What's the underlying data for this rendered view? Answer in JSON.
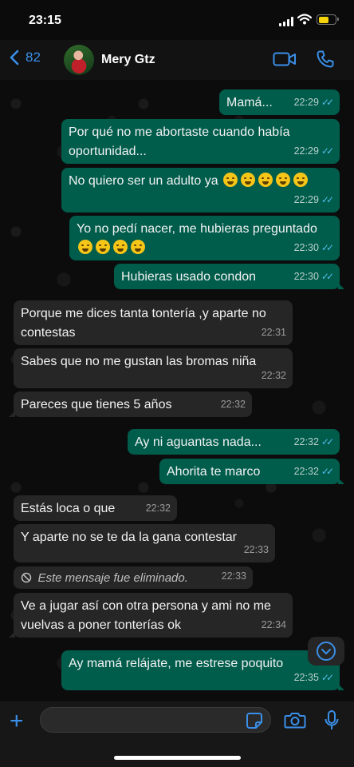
{
  "status_bar": {
    "time": "23:15"
  },
  "header": {
    "back_count": "82",
    "contact_name": "Mery Gtz"
  },
  "messages": [
    {
      "text": "Mamá...",
      "time": "22:29"
    },
    {
      "text": "Por qué no me abortaste cuando había oportunidad...",
      "time": "22:29"
    },
    {
      "text": "No quiero ser un adulto ya",
      "time": "22:29"
    },
    {
      "text": "Yo no pedí nacer, me hubieras preguntado",
      "time": "22:30"
    },
    {
      "text": "Hubieras usado condon",
      "time": "22:30"
    },
    {
      "text": "Porque me dices tanta tontería ,y aparte no contestas",
      "time": "22:31"
    },
    {
      "text": "Sabes que no me gustan las bromas niña",
      "time": "22:32"
    },
    {
      "text": "Pareces que tienes 5 años",
      "time": "22:32"
    },
    {
      "text": "Ay ni aguantas nada...",
      "time": "22:32"
    },
    {
      "text": "Ahorita te marco",
      "time": "22:32"
    },
    {
      "text": "Estás loca o que",
      "time": "22:32"
    },
    {
      "text": "Y aparte no se te da la gana contestar",
      "time": "22:33"
    },
    {
      "text": "Este mensaje fue eliminado.",
      "time": "22:33"
    },
    {
      "text": "Ve a jugar así con otra persona y ami no me vuelvas a poner tonterías ok",
      "time": "22:34"
    },
    {
      "text": "Ay mamá relájate, me estrese poquito",
      "time": "22:35"
    }
  ],
  "composer": {
    "placeholder": ""
  },
  "colors": {
    "accent": "#3a8fe8",
    "outgoing_bubble": "#005c4b",
    "incoming_bubble": "#262626",
    "read_ticks": "#53bdeb"
  },
  "icons": [
    "back-chevron-icon",
    "video-call-icon",
    "phone-icon",
    "double-check-icon",
    "deleted-icon",
    "scroll-down-icon",
    "plus-icon",
    "sticker-icon",
    "camera-icon",
    "mic-icon"
  ]
}
